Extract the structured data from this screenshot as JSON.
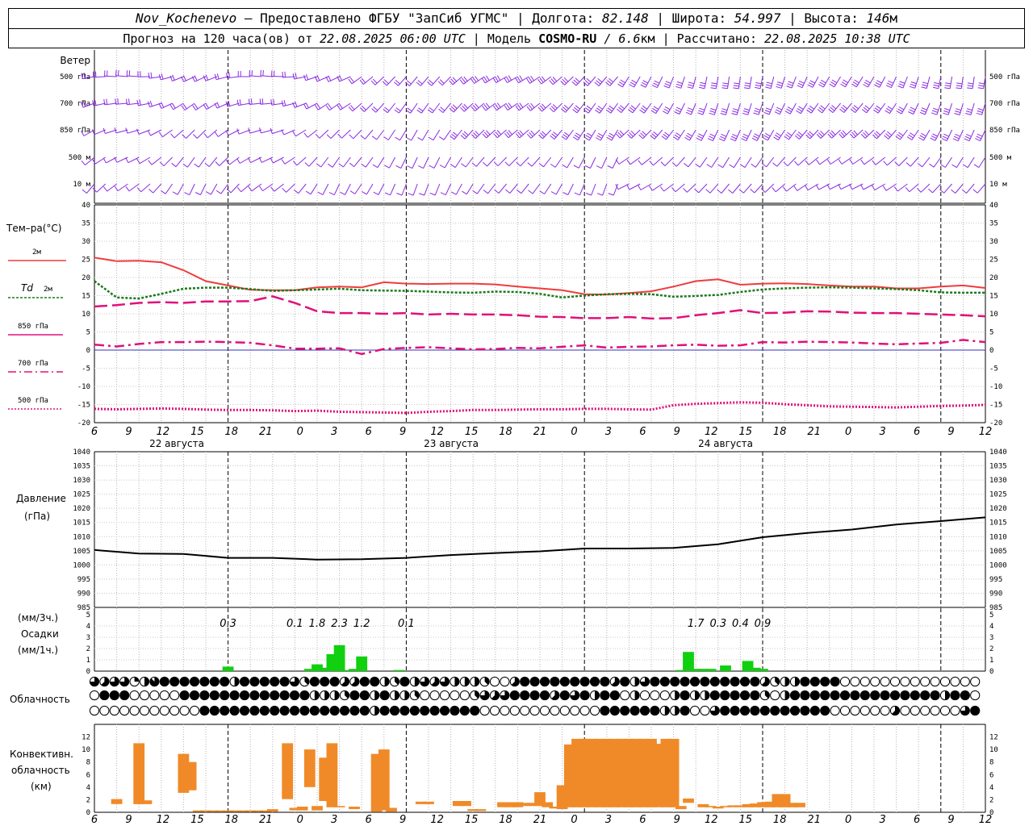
{
  "header": {
    "station": "Nov_Kochenevo",
    "provider": " – Предоставлено ФГБУ \"ЗапСиб УГМС\" | Долгота: ",
    "lon": "82.148",
    "lat_label": " | Широта: ",
    "lat": "54.997",
    "alt_label": " | Высота: ",
    "alt": "146",
    "alt_unit": "м",
    "fc_prefix": "Прогноз на 120 часа(ов) от ",
    "fc_date": "22.08.2025 06:00 UTC",
    "model_label": " | Модель ",
    "model": "COSMO-RU",
    "model_res": " / 6.6",
    "model_res_unit": "км",
    "calc_label": " | Рассчитано: ",
    "calc_date": "22.08.2025 10:38 UTC"
  },
  "labels": {
    "wind": "Ветер",
    "wind_levels": [
      "500 гПа",
      "700 гПа",
      "850 гПа",
      "500 м",
      "10  м"
    ],
    "temp": "Тем–ра(°С)",
    "l_2m": "2м",
    "l_td": "Td",
    "l_td2": "2м",
    "l_850": "850 гПа",
    "l_700": "700 гПа",
    "l_500": "500 гПа",
    "pressure1": "Давление",
    "pressure2": "(гПа)",
    "precip1": "(мм/3ч.)",
    "precip2": "Осадки",
    "precip3": "(мм/1ч.)",
    "cloud": "Облачность",
    "conv1": "Конвективн.",
    "conv2": "облачность",
    "conv3": "(км)"
  },
  "colors": {
    "wind": "#8a2be2",
    "t2m": "#f03c3c",
    "td": "#1a7a1a",
    "t850": "#e0107a",
    "t700": "#e0107a",
    "t500": "#e0107a",
    "precip": "#10d010",
    "conv": "#f08a28",
    "zero": "#3030c0"
  },
  "x_axis": {
    "hour_labels": [
      "6",
      "9",
      "12",
      "15",
      "18",
      "21",
      "0",
      "3",
      "6",
      "9",
      "12",
      "15",
      "18",
      "21",
      "0",
      "3",
      "6",
      "9",
      "12",
      "15",
      "18",
      "21",
      "0",
      "3",
      "6",
      "9",
      "12"
    ],
    "day_labels": [
      "22 августа",
      "23 августа",
      "24 августа"
    ]
  },
  "chart_data": [
    {
      "type": "line",
      "name": "temperature",
      "ylim": [
        -20,
        40
      ],
      "yticks": [
        -20,
        -15,
        -10,
        -5,
        0,
        5,
        10,
        15,
        20,
        25,
        30,
        35,
        40
      ],
      "x_hours": [
        0,
        3,
        6,
        9,
        12,
        15,
        18,
        21,
        24,
        27,
        30,
        33,
        36,
        39,
        42,
        45,
        48,
        51,
        54,
        57,
        60,
        63,
        66,
        69,
        72,
        75,
        78,
        81,
        84,
        87,
        90,
        93,
        96,
        99,
        102,
        105,
        108,
        111,
        114,
        117,
        120
      ],
      "series": [
        {
          "name": "2м",
          "values": [
            25.5,
            24.5,
            24.6,
            24.2,
            22,
            19,
            17.8,
            16.6,
            16.5,
            16.5,
            17.3,
            17.5,
            17.3,
            18.7,
            18.3,
            18.2,
            18.3,
            18.3,
            18.1,
            17.5,
            17,
            16.5,
            15.4,
            15.3,
            15.7,
            16.2,
            17.5,
            19,
            19.5,
            18,
            18.3,
            18.4,
            18.2,
            17.8,
            17.5,
            17.5,
            17,
            17,
            17.5,
            17.8,
            17.1
          ]
        },
        {
          "name": "Td 2м",
          "values": [
            19,
            14.5,
            14.2,
            15.5,
            16.9,
            17.2,
            17.2,
            16.8,
            16.3,
            16.5,
            16.7,
            16.9,
            16.5,
            16.4,
            16.3,
            16.1,
            15.9,
            15.8,
            16.1,
            16,
            15.5,
            14.5,
            15,
            15.4,
            15.5,
            15.4,
            14.7,
            14.9,
            15.2,
            16,
            16.7,
            17,
            17.2,
            17.3,
            17.2,
            17,
            16.8,
            16.5,
            15.9,
            15.8,
            15.8
          ]
        },
        {
          "name": "850 гПа",
          "values": [
            12,
            12.4,
            13,
            13.2,
            13,
            13.4,
            13.4,
            13.5,
            14.8,
            13,
            10.7,
            10.2,
            10.2,
            10,
            10.2,
            9.8,
            10,
            9.8,
            9.8,
            9.6,
            9.2,
            9.1,
            8.8,
            8.8,
            9.1,
            8.7,
            8.8,
            9.6,
            10.2,
            11,
            10.2,
            10.3,
            10.7,
            10.6,
            10.3,
            10.2,
            10.2,
            10,
            9.8,
            9.6,
            9.3
          ]
        },
        {
          "name": "700 гПа",
          "values": [
            1.5,
            1,
            1.7,
            2.2,
            2.2,
            2.3,
            2.2,
            2,
            1.3,
            0.4,
            0.4,
            0.5,
            -1.1,
            0.3,
            0.6,
            0.8,
            0.5,
            0.2,
            0.3,
            0.6,
            0.5,
            0.9,
            1.3,
            0.7,
            0.9,
            1,
            1.3,
            1.5,
            1.2,
            1.3,
            2.2,
            2.1,
            2.3,
            2.2,
            2.1,
            1.8,
            1.6,
            1.8,
            2,
            2.8,
            2.2
          ]
        },
        {
          "name": "500 гПа",
          "values": [
            -16.2,
            -16.3,
            -16.2,
            -16.1,
            -16.2,
            -16.4,
            -16.5,
            -16.5,
            -16.6,
            -16.8,
            -16.7,
            -17,
            -17.1,
            -17.2,
            -17.3,
            -17,
            -16.8,
            -16.5,
            -16.5,
            -16.4,
            -16.3,
            -16.3,
            -16.2,
            -16.2,
            -16.3,
            -16.4,
            -15.2,
            -14.8,
            -14.6,
            -14.4,
            -14.5,
            -14.9,
            -15.2,
            -15.5,
            -15.6,
            -15.7,
            -15.8,
            -15.6,
            -15.4,
            -15.3,
            -15.1
          ]
        }
      ]
    },
    {
      "type": "line",
      "name": "pressure",
      "ylim": [
        985,
        1040
      ],
      "yticks": [
        985,
        990,
        995,
        1000,
        1005,
        1010,
        1015,
        1020,
        1025,
        1030,
        1035,
        1040
      ],
      "x_hours": [
        0,
        6,
        12,
        18,
        24,
        30,
        36,
        42,
        48,
        54,
        60,
        66,
        72,
        78,
        84,
        90,
        96,
        102,
        108,
        114,
        120
      ],
      "values": [
        1005.3,
        1004,
        1003.9,
        1002.5,
        1002.5,
        1001.9,
        1002,
        1002.5,
        1003.5,
        1004.2,
        1004.8,
        1005.8,
        1005.8,
        1006,
        1007.3,
        1009.8,
        1011.3,
        1012.5,
        1014.3,
        1015.5,
        1016.8
      ]
    },
    {
      "type": "bar",
      "name": "precipitation",
      "ylim": [
        0,
        5
      ],
      "yticks": [
        0,
        1,
        2,
        3,
        4,
        5
      ],
      "bars": [
        {
          "h": 18,
          "v": 0.4
        },
        {
          "h": 29,
          "v": 0.2
        },
        {
          "h": 30,
          "v": 0.6
        },
        {
          "h": 31,
          "v": 0.3
        },
        {
          "h": 32,
          "v": 1.5
        },
        {
          "h": 33,
          "v": 2.3
        },
        {
          "h": 34,
          "v": 0.1
        },
        {
          "h": 35,
          "v": 0.2
        },
        {
          "h": 36,
          "v": 1.3
        },
        {
          "h": 41,
          "v": 0.1
        },
        {
          "h": 79,
          "v": 0.1
        },
        {
          "h": 80,
          "v": 1.7
        },
        {
          "h": 81,
          "v": 0.2
        },
        {
          "h": 82,
          "v": 0.2
        },
        {
          "h": 83,
          "v": 0.2
        },
        {
          "h": 85,
          "v": 0.5
        },
        {
          "h": 88,
          "v": 0.9
        },
        {
          "h": 89,
          "v": 0.3
        },
        {
          "h": 90,
          "v": 0.2
        }
      ],
      "totals": [
        {
          "h": 18,
          "label": "0.3"
        },
        {
          "h": 27,
          "label": "0.1"
        },
        {
          "h": 30,
          "label": "1.8"
        },
        {
          "h": 33,
          "label": "2.3"
        },
        {
          "h": 36,
          "label": "1.2"
        },
        {
          "h": 42,
          "label": "0.1"
        },
        {
          "h": 81,
          "label": "1.7"
        },
        {
          "h": 84,
          "label": "0.3"
        },
        {
          "h": 87,
          "label": "0.4"
        },
        {
          "h": 90,
          "label": "0.9"
        }
      ]
    },
    {
      "type": "bar",
      "name": "convective_cloud",
      "ylim": [
        0,
        14
      ],
      "yticks": [
        0,
        2,
        4,
        6,
        8,
        10,
        12
      ],
      "bars": [
        {
          "h": 3,
          "b": 1.3,
          "t": 2.1
        },
        {
          "h": 6,
          "b": 1.3,
          "t": 11
        },
        {
          "h": 7,
          "b": 1.3,
          "t": 1.9
        },
        {
          "h": 12,
          "b": 3.1,
          "t": 9.3
        },
        {
          "h": 13,
          "b": 3.5,
          "t": 8
        },
        {
          "h": 14,
          "b": 0.1,
          "t": 0.3
        },
        {
          "h": 15,
          "b": 0.1,
          "t": 0.3
        },
        {
          "h": 16,
          "b": 0.1,
          "t": 0.3
        },
        {
          "h": 17,
          "b": 0.1,
          "t": 0.3
        },
        {
          "h": 18,
          "b": 0.1,
          "t": 0.3
        },
        {
          "h": 19,
          "b": 0.1,
          "t": 0.3
        },
        {
          "h": 20,
          "b": 0.1,
          "t": 0.3
        },
        {
          "h": 21,
          "b": 0.1,
          "t": 0.3
        },
        {
          "h": 22,
          "b": 0.1,
          "t": 0.3
        },
        {
          "h": 23,
          "b": 0.1,
          "t": 0.3
        },
        {
          "h": 24,
          "b": 0.1,
          "t": 0.5
        },
        {
          "h": 26,
          "b": 2.1,
          "t": 11
        },
        {
          "h": 27,
          "b": 0.3,
          "t": 0.7
        },
        {
          "h": 28,
          "b": 0.3,
          "t": 0.9
        },
        {
          "h": 29,
          "b": 4,
          "t": 10
        },
        {
          "h": 30,
          "b": 0.3,
          "t": 1
        },
        {
          "h": 31,
          "b": 1.8,
          "t": 8.7
        },
        {
          "h": 32,
          "b": 0.8,
          "t": 11
        },
        {
          "h": 33,
          "b": 0.8,
          "t": 1
        },
        {
          "h": 35,
          "b": 0.5,
          "t": 0.9
        },
        {
          "h": 38,
          "b": 0.1,
          "t": 9.3
        },
        {
          "h": 39,
          "b": 0.3,
          "t": 10
        },
        {
          "h": 40,
          "b": 0.1,
          "t": 0.7
        },
        {
          "h": 44,
          "b": 1.3,
          "t": 1.7
        },
        {
          "h": 45,
          "b": 1.3,
          "t": 1.7
        },
        {
          "h": 49,
          "b": 1,
          "t": 1.8
        },
        {
          "h": 50,
          "b": 1,
          "t": 1.8
        },
        {
          "h": 51,
          "b": 0.2,
          "t": 0.5
        },
        {
          "h": 52,
          "b": 0.2,
          "t": 0.5
        },
        {
          "h": 55,
          "b": 0.8,
          "t": 1.6
        },
        {
          "h": 56,
          "b": 0.8,
          "t": 1.6
        },
        {
          "h": 57,
          "b": 0.8,
          "t": 1.6
        },
        {
          "h": 58,
          "b": 1,
          "t": 1.5
        },
        {
          "h": 59,
          "b": 1,
          "t": 1.5
        },
        {
          "h": 60,
          "b": 1,
          "t": 3.2
        },
        {
          "h": 61,
          "b": 0.8,
          "t": 1.6
        },
        {
          "h": 62,
          "b": 0.6,
          "t": 0.9
        },
        {
          "h": 63,
          "b": 0.5,
          "t": 4.3
        },
        {
          "h": 64,
          "b": 0.8,
          "t": 10.8
        },
        {
          "h": 65,
          "b": 0.8,
          "t": 11.7
        },
        {
          "h": 66,
          "b": 0.8,
          "t": 11.7
        },
        {
          "h": 67,
          "b": 0.8,
          "t": 11.7
        },
        {
          "h": 68,
          "b": 0.8,
          "t": 11.7
        },
        {
          "h": 69,
          "b": 0.8,
          "t": 11.7
        },
        {
          "h": 70,
          "b": 0.8,
          "t": 11.7
        },
        {
          "h": 71,
          "b": 0.8,
          "t": 11.7
        },
        {
          "h": 72,
          "b": 0.8,
          "t": 11.7
        },
        {
          "h": 73,
          "b": 0.8,
          "t": 11.7
        },
        {
          "h": 74,
          "b": 0.8,
          "t": 11.7
        },
        {
          "h": 75,
          "b": 0.8,
          "t": 11.7
        },
        {
          "h": 76,
          "b": 0.8,
          "t": 10.9
        },
        {
          "h": 77,
          "b": 0.8,
          "t": 11.7
        },
        {
          "h": 78,
          "b": 0.8,
          "t": 11.7
        },
        {
          "h": 79,
          "b": 0.5,
          "t": 1
        },
        {
          "h": 80,
          "b": 1.5,
          "t": 2.2
        },
        {
          "h": 82,
          "b": 0.8,
          "t": 1.3
        },
        {
          "h": 83,
          "b": 0.8,
          "t": 1
        },
        {
          "h": 84,
          "b": 0.6,
          "t": 0.9
        },
        {
          "h": 85,
          "b": 0.8,
          "t": 1
        },
        {
          "h": 86,
          "b": 0.8,
          "t": 1.1
        },
        {
          "h": 87,
          "b": 0.8,
          "t": 1.1
        },
        {
          "h": 88,
          "b": 0.8,
          "t": 1.3
        },
        {
          "h": 89,
          "b": 0.8,
          "t": 1.4
        },
        {
          "h": 90,
          "b": 0.8,
          "t": 1.6
        },
        {
          "h": 91,
          "b": 0.8,
          "t": 1.7
        },
        {
          "h": 92,
          "b": 0.8,
          "t": 2.9
        },
        {
          "h": 93,
          "b": 0.8,
          "t": 2.9
        },
        {
          "h": 94,
          "b": 0.8,
          "t": 1.5
        },
        {
          "h": 95,
          "b": 0.8,
          "t": 1.5
        }
      ]
    },
    {
      "type": "table",
      "name": "cloudiness_octas",
      "rows": [
        [
          6,
          5,
          6,
          6,
          2,
          4,
          7,
          8,
          8,
          8,
          8,
          8,
          8,
          8,
          4,
          8,
          8,
          8,
          8,
          8,
          6,
          3,
          8,
          8,
          8,
          5,
          5,
          8,
          8,
          4,
          3,
          8,
          4,
          6,
          5,
          6,
          4,
          4,
          4,
          3,
          0,
          0,
          5,
          8,
          8,
          8,
          8,
          8,
          8,
          8,
          8,
          8,
          5,
          8,
          4,
          6,
          8,
          8,
          8,
          8,
          8,
          8,
          8,
          8,
          8,
          8,
          8,
          5,
          3,
          4,
          4,
          8,
          8,
          8,
          8,
          0,
          0,
          0,
          0,
          0,
          0,
          0,
          0,
          0,
          0,
          0,
          0,
          0,
          0
        ],
        [
          0,
          8,
          8,
          8,
          0,
          0,
          0,
          0,
          0,
          8,
          8,
          8,
          8,
          8,
          8,
          8,
          8,
          8,
          8,
          8,
          8,
          8,
          4,
          4,
          4,
          3,
          8,
          8,
          4,
          8,
          4,
          4,
          3,
          0,
          0,
          0,
          0,
          0,
          3,
          6,
          5,
          6,
          8,
          8,
          8,
          8,
          5,
          8,
          6,
          8,
          4,
          8,
          8,
          0,
          4,
          0,
          0,
          0,
          4,
          8,
          4,
          4,
          8,
          8,
          8,
          8,
          8,
          3,
          0,
          4,
          8,
          8,
          8,
          8,
          8,
          8,
          8,
          8,
          8,
          8,
          8,
          8,
          8,
          8,
          8,
          4,
          8,
          8,
          0
        ],
        [
          0,
          0,
          0,
          0,
          0,
          0,
          0,
          0,
          0,
          0,
          0,
          8,
          8,
          8,
          8,
          8,
          8,
          8,
          8,
          8,
          8,
          8,
          8,
          8,
          8,
          8,
          8,
          8,
          4,
          8,
          8,
          8,
          8,
          8,
          8,
          8,
          8,
          8,
          8,
          0,
          0,
          0,
          0,
          0,
          0,
          0,
          0,
          0,
          0,
          0,
          0,
          8,
          8,
          8,
          8,
          8,
          8,
          4,
          4,
          8,
          0,
          0,
          6,
          8,
          8,
          8,
          8,
          8,
          8,
          8,
          8,
          8,
          8,
          8,
          0,
          0,
          0,
          0,
          0,
          0,
          5,
          0,
          0,
          0,
          0,
          0,
          0,
          6,
          8
        ]
      ]
    }
  ]
}
